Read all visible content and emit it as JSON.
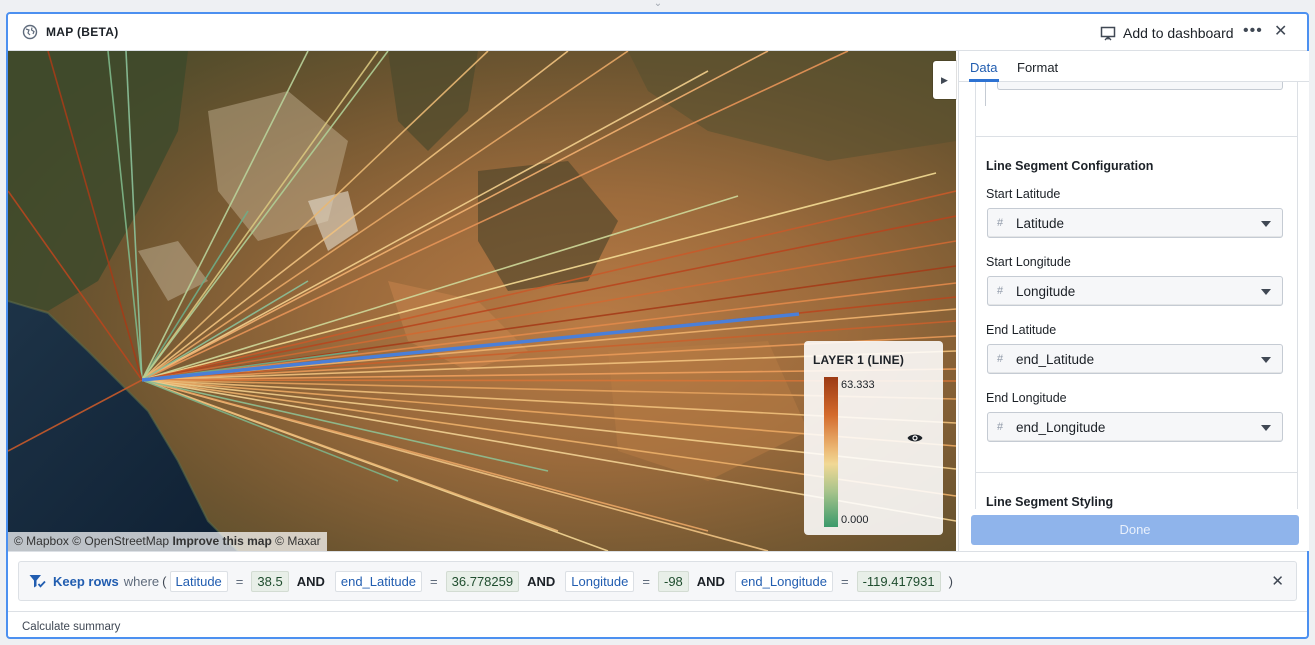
{
  "header": {
    "title": "MAP (BETA)",
    "add_to_dashboard": "Add to dashboard",
    "more_label": "•••",
    "close_label": "✕"
  },
  "map": {
    "attribution": {
      "mapbox": "© Mapbox",
      "osm": "© OpenStreetMap",
      "improve": "Improve this map",
      "maxar": "© Maxar"
    },
    "legend": {
      "title": "LAYER 1 (LINE)",
      "max": "63.333",
      "min": "0.000"
    },
    "colors": {
      "selected_line": "#4a7fd8",
      "ramp_high": "#9c3a14",
      "ramp_mid": "#f1d894",
      "ramp_low": "#3b9a6b"
    }
  },
  "panel": {
    "tabs": [
      {
        "label": "Data",
        "active": true
      },
      {
        "label": "Format",
        "active": false
      }
    ],
    "sections": [
      {
        "title": "Line Segment Configuration",
        "fields": [
          {
            "label": "Start Latitude",
            "value": "Latitude"
          },
          {
            "label": "Start Longitude",
            "value": "Longitude"
          },
          {
            "label": "End Latitude",
            "value": "end_Latitude"
          },
          {
            "label": "End Longitude",
            "value": "end_Longitude"
          }
        ]
      },
      {
        "title": "Line Segment Styling"
      }
    ],
    "done_label": "Done"
  },
  "filter": {
    "keep_label": "Keep rows",
    "where_label": "where",
    "open_paren": "(",
    "close_paren": ")",
    "and_label": "AND",
    "eq_label": "=",
    "conditions": [
      {
        "column": "Latitude",
        "value": "38.5"
      },
      {
        "column": "end_Latitude",
        "value": "36.778259"
      },
      {
        "column": "Longitude",
        "value": "-98"
      },
      {
        "column": "end_Longitude",
        "value": "-119.417931"
      }
    ]
  },
  "footer": {
    "label": "Calculate summary"
  }
}
